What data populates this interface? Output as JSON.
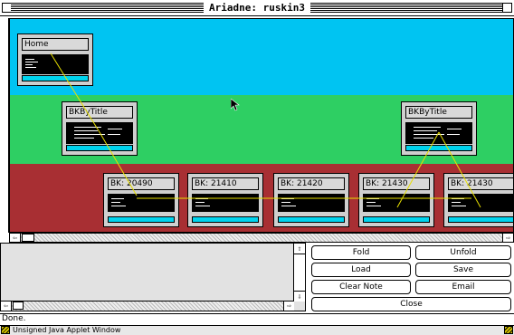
{
  "window": {
    "title": "Ariadne: ruskin3"
  },
  "nodes": {
    "home": "Home",
    "bkbytitle_1": "BKByTitle",
    "bkbytitle_2": "BKByTitle",
    "bk_20490": "BK: 20490",
    "bk_21410": "BK: 21410",
    "bk_21420": "BK: 21420",
    "bk_21430a": "BK: 21430",
    "bk_21430b": "BK: 21430"
  },
  "buttons": {
    "fold": "Fold",
    "unfold": "Unfold",
    "load": "Load",
    "save": "Save",
    "clear_note": "Clear Note",
    "email": "Email",
    "close": "Close"
  },
  "notes": {
    "value": ""
  },
  "status": {
    "text": "Done."
  },
  "applet": {
    "warning": "Unsigned Java Applet Window"
  },
  "colors": {
    "band_top": "#00c4f2",
    "band_middle": "#2ecf63",
    "band_bottom": "#a82f33",
    "node_bar": "#00d4ee",
    "link_line": "#e8e000"
  }
}
